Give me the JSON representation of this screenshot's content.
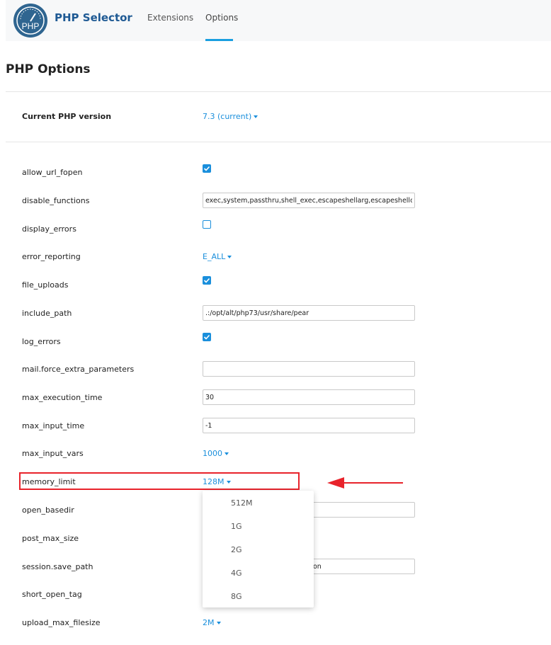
{
  "header": {
    "logo_text": "PHP",
    "app_title": "PHP Selector",
    "tabs": [
      {
        "label": "Extensions"
      },
      {
        "label": "Options"
      }
    ],
    "active_tab": "Options"
  },
  "page_title": "PHP Options",
  "php_version": {
    "label": "Current PHP version",
    "value": "7.3 (current)"
  },
  "options": [
    {
      "name": "allow_url_fopen",
      "type": "checkbox",
      "checked": true
    },
    {
      "name": "disable_functions",
      "type": "text",
      "value": "exec,system,passthru,shell_exec,escapeshellarg,escapeshellcmd"
    },
    {
      "name": "display_errors",
      "type": "checkbox",
      "checked": false
    },
    {
      "name": "error_reporting",
      "type": "select",
      "value": "E_ALL"
    },
    {
      "name": "file_uploads",
      "type": "checkbox",
      "checked": true
    },
    {
      "name": "include_path",
      "type": "text",
      "value": ".:/opt/alt/php73/usr/share/pear"
    },
    {
      "name": "log_errors",
      "type": "checkbox",
      "checked": true
    },
    {
      "name": "mail.force_extra_parameters",
      "type": "text",
      "value": ""
    },
    {
      "name": "max_execution_time",
      "type": "text",
      "value": "30"
    },
    {
      "name": "max_input_time",
      "type": "text",
      "value": "-1"
    },
    {
      "name": "max_input_vars",
      "type": "select",
      "value": "1000"
    },
    {
      "name": "memory_limit",
      "type": "select",
      "value": "128M"
    },
    {
      "name": "open_basedir",
      "type": "text",
      "value": ""
    },
    {
      "name": "post_max_size",
      "type": "select",
      "value": ""
    },
    {
      "name": "session.save_path",
      "type": "text",
      "value": "on"
    },
    {
      "name": "short_open_tag",
      "type": "checkbox",
      "checked": false
    },
    {
      "name": "upload_max_filesize",
      "type": "select",
      "value": "2M"
    }
  ],
  "memory_limit_dropdown": {
    "options": [
      "512M",
      "1G",
      "2G",
      "4G",
      "8G"
    ]
  },
  "colors": {
    "accent": "#1a8fdc",
    "brand": "#1f5a94",
    "highlight": "#e8232b"
  }
}
